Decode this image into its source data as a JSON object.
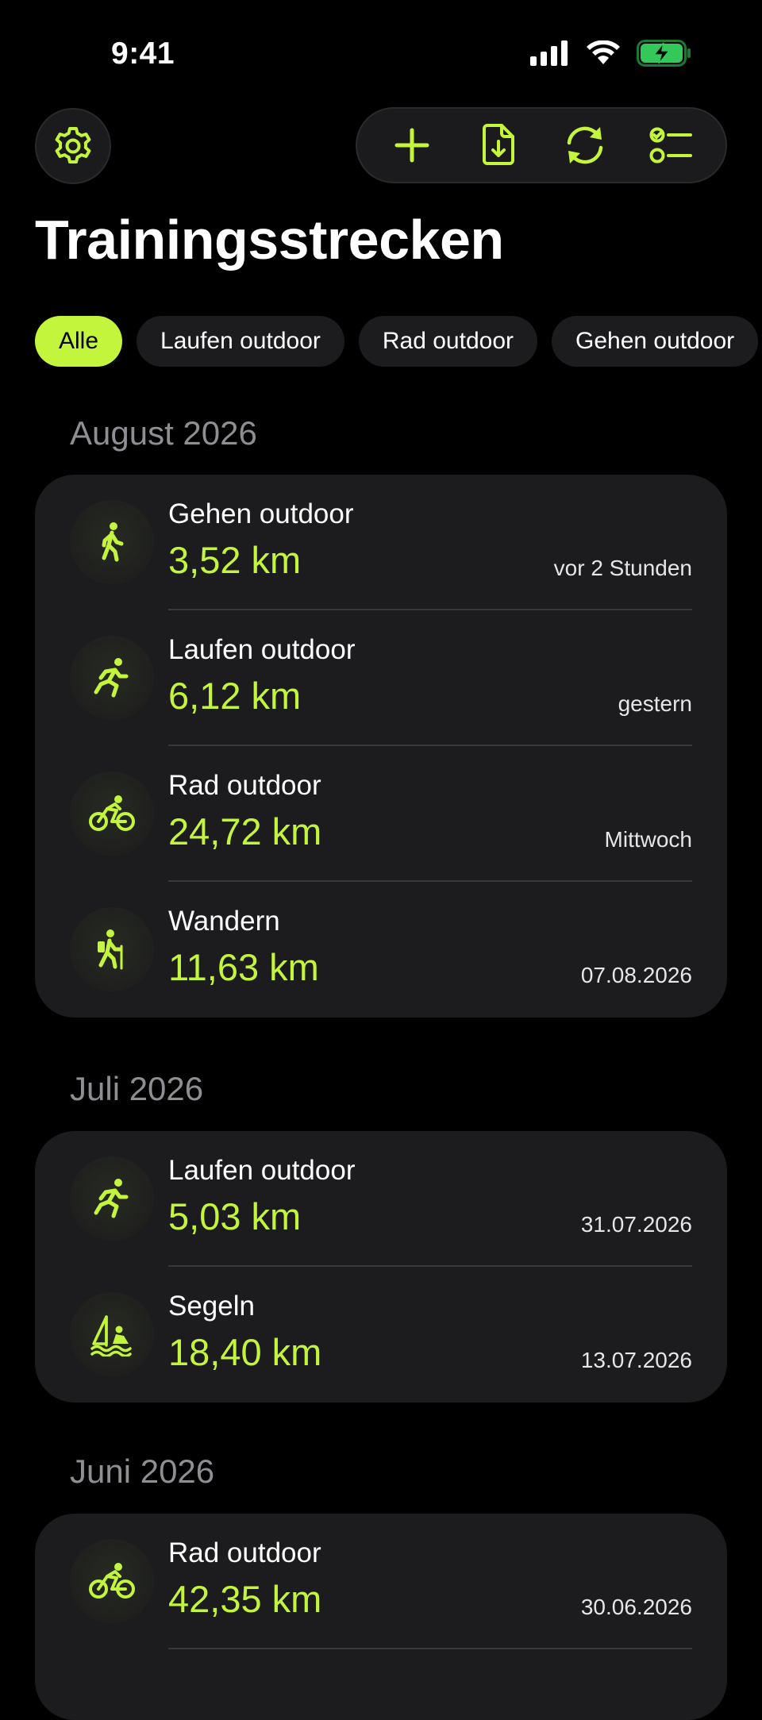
{
  "status": {
    "time": "9:41"
  },
  "title": "Trainingsstrecken",
  "filters": [
    "Alle",
    "Laufen outdoor",
    "Rad outdoor",
    "Gehen outdoor"
  ],
  "accent_color": "#c3f53c",
  "toolbar": {
    "settings_icon": "gear-icon",
    "actions": [
      "plus-icon",
      "file-download-icon",
      "sync-icon",
      "checklist-icon"
    ]
  },
  "sections": [
    {
      "header": "August 2026",
      "rows": [
        {
          "icon": "walking-icon",
          "name": "Gehen outdoor",
          "distance": "3,52 km",
          "date": "vor 2 Stunden"
        },
        {
          "icon": "running-icon",
          "name": "Laufen outdoor",
          "distance": "6,12 km",
          "date": "gestern"
        },
        {
          "icon": "cycling-icon",
          "name": "Rad outdoor",
          "distance": "24,72 km",
          "date": "Mittwoch"
        },
        {
          "icon": "hiking-icon",
          "name": "Wandern",
          "distance": "11,63 km",
          "date": "07.08.2026"
        }
      ]
    },
    {
      "header": "Juli 2026",
      "rows": [
        {
          "icon": "running-icon",
          "name": "Laufen outdoor",
          "distance": "5,03 km",
          "date": "31.07.2026"
        },
        {
          "icon": "sailing-icon",
          "name": "Segeln",
          "distance": "18,40 km",
          "date": "13.07.2026"
        }
      ]
    },
    {
      "header": "Juni 2026",
      "rows": [
        {
          "icon": "cycling-icon",
          "name": "Rad outdoor",
          "distance": "42,35 km",
          "date": "30.06.2026"
        }
      ]
    }
  ]
}
